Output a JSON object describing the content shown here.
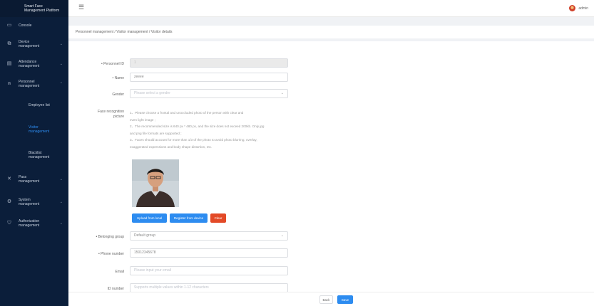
{
  "app": {
    "title_line1": "Smart Face",
    "title_line2": "Management Platform"
  },
  "header": {
    "menu_icon": "hamburger-icon",
    "user_name": "admin"
  },
  "sidebar": {
    "items": [
      {
        "label": "Console",
        "icon": "monitor-icon",
        "has_arrow": false
      },
      {
        "label_1": "Device",
        "label_2": "management",
        "icon": "device-icon",
        "has_arrow": true
      },
      {
        "label_1": "Attendance",
        "label_2": "management",
        "icon": "calendar-icon",
        "has_arrow": true
      },
      {
        "label_1": "Personnel",
        "label_2": "management",
        "icon": "person-icon",
        "has_arrow": true
      }
    ],
    "sub_items": [
      {
        "label": "Employee list"
      },
      {
        "label_1": "Visitor",
        "label_2": "management"
      },
      {
        "label_1": "Blacklist",
        "label_2": "management"
      }
    ],
    "items_after": [
      {
        "label_1": "Pass",
        "label_2": "management",
        "icon": "pass-icon"
      },
      {
        "label_1": "System",
        "label_2": "management",
        "icon": "gear-icon"
      },
      {
        "label_1": "Authorization",
        "label_2": "management",
        "icon": "shield-icon"
      }
    ]
  },
  "breadcrumb": "Personnel management / Visitor management / Visitor details",
  "form": {
    "personnel_id": {
      "label": "• Personnel ID",
      "value": "1"
    },
    "name": {
      "label": "• Name",
      "value": "zeeee"
    },
    "gender": {
      "label": "Gender",
      "placeholder": "Please select a gender"
    },
    "face_recognition": {
      "label_1": "Face recognition",
      "label_2": "picture",
      "notice": [
        "1、Please choose a frontal and unoccluded photo of the person with clear and",
        "even light image ;",
        "2、The recommended size is 640 px * 480 px, and the size does not exceed 200kb. Only jpg",
        "and png file formats are supported ;",
        "3、Faces should account for more than 1/3 of the photo to avoid photo blurring, overlay,",
        "exaggerated expressions and body shape distortion, etc."
      ],
      "buttons": {
        "upload": "Upload from local",
        "register": "Register from device",
        "clear": "Clear"
      }
    },
    "group": {
      "label": "• Belonging group",
      "value": "Default group"
    },
    "phone": {
      "label": "• Phone number",
      "value": "15012345678"
    },
    "email": {
      "label": "Email",
      "placeholder": "Please input your email"
    },
    "id_number": {
      "label": "ID number",
      "placeholder": "Supports multiple values within 1-12 characters"
    }
  },
  "footer": {
    "back": "Back",
    "save": "Save"
  },
  "colors": {
    "sidebar_bg": "#0b1e3a",
    "accent": "#2d8cf0",
    "danger": "#e34a27"
  }
}
